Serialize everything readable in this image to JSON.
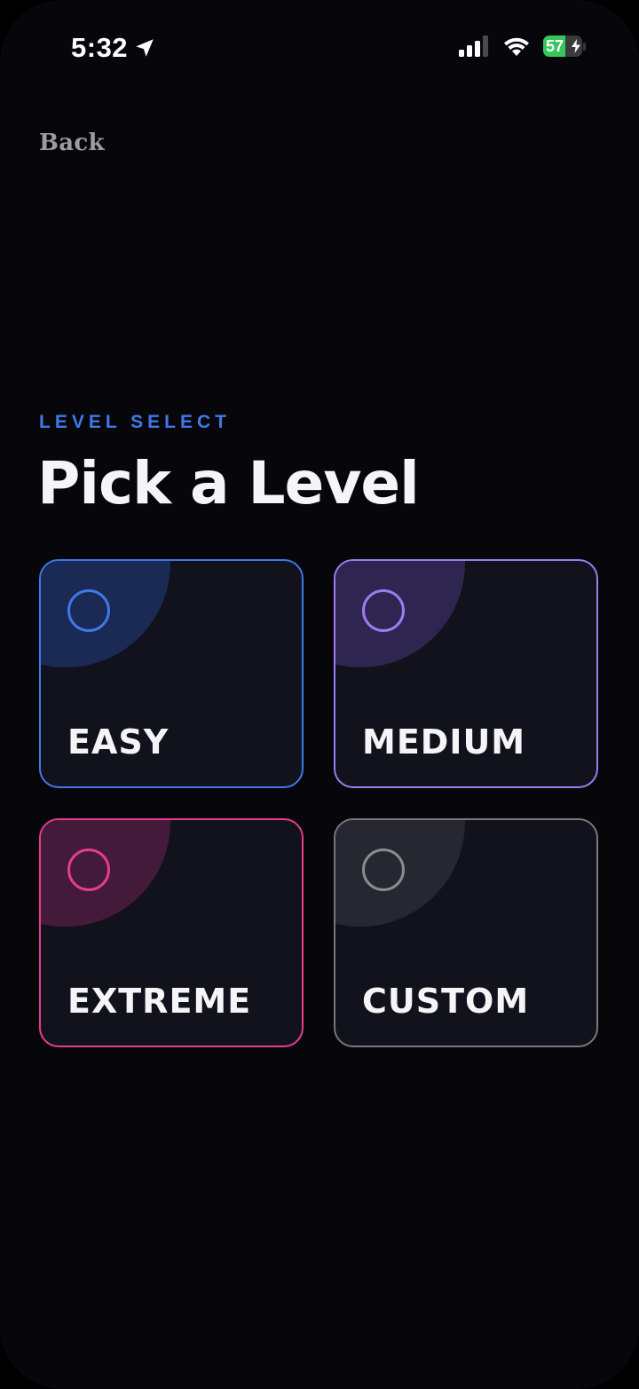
{
  "status_bar": {
    "time": "5:32",
    "battery_percent": 57,
    "battery_label": "57",
    "charging": true,
    "signal_bars": 3,
    "icons": [
      "location-arrow-icon",
      "cellular-signal-icon",
      "wifi-icon",
      "battery-icon",
      "charging-bolt-icon"
    ]
  },
  "nav": {
    "back_label": "Back"
  },
  "header": {
    "eyebrow": "LEVEL SELECT",
    "title": "Pick a Level"
  },
  "levels": [
    {
      "label": "EASY",
      "accent": "#3f78e8"
    },
    {
      "label": "MEDIUM",
      "accent": "#9c7cf0"
    },
    {
      "label": "EXTREME",
      "accent": "#e73b8f"
    },
    {
      "label": "CUSTOM",
      "accent": "#8b8b92"
    }
  ],
  "colors": {
    "background": "#07070b",
    "card_background": "#11121b",
    "text_primary": "#f5f5f7",
    "text_secondary": "#9b9ba3",
    "eyebrow": "#3f78e8"
  }
}
